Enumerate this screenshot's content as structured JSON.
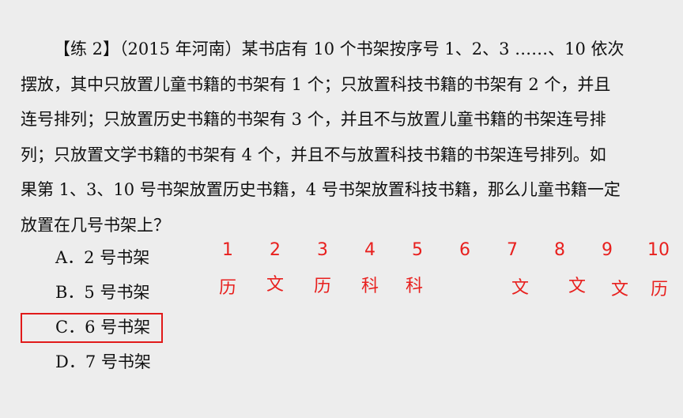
{
  "problem": {
    "lines": [
      "【练 2】（2015 年河南）某书店有 10 个书架按序号 1、2、3 ……、10 依次",
      "摆放，其中只放置儿童书籍的书架有 1 个；只放置科技书籍的书架有 2 个，并且",
      "连号排列；只放置历史书籍的书架有 3 个，并且不与放置儿童书籍的书架连号排",
      "列；只放置文学书籍的书架有 4 个，并且不与放置科技书籍的书架连号排列。如",
      "果第 1、3、10 号书架放置历史书籍，4 号书架放置科技书籍，那么儿童书籍一定",
      "放置在几号书架上？"
    ]
  },
  "options": {
    "a": "A．2 号书架",
    "b": "B．5 号书架",
    "c": "C．6 号书架",
    "d": "D．7 号书架"
  },
  "answer": "C",
  "annotation": {
    "color": "#e8201e",
    "numbers": [
      "1",
      "2",
      "3",
      "4",
      "5",
      "6",
      "7",
      "8",
      "9",
      "10"
    ],
    "categories": [
      "历",
      "文",
      "历",
      "科",
      "科",
      "",
      "文",
      "文",
      "文",
      "历"
    ]
  }
}
